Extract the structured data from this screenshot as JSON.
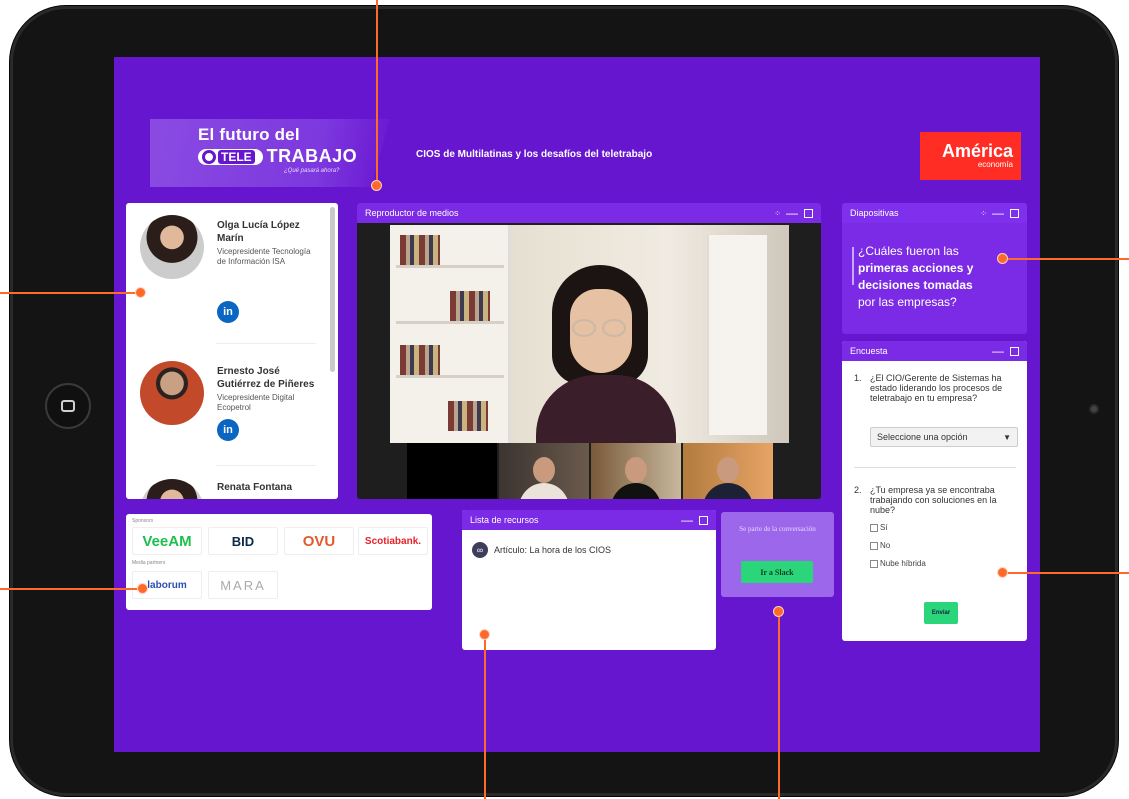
{
  "header": {
    "logo_line1": "El futuro del",
    "logo_badge": "TELE",
    "logo_trabajo": "TRABAJO",
    "logo_tagline": "¿Qué pasará ahora?",
    "event_title": "CIOS de Multilatinas y los desafíos del teletrabajo",
    "brand_big": "América",
    "brand_small": "economía"
  },
  "speakers": [
    {
      "name": "Olga Lucía López Marín",
      "role": "Vicepresidente Tecnología de Información ISA",
      "linkedin": "in"
    },
    {
      "name": "Ernesto José Gutiérrez de Piñeres",
      "role": "Vicepresidente Digital Ecopetrol",
      "linkedin": "in"
    },
    {
      "name": "Renata Fontana",
      "role": "",
      "linkedin": ""
    }
  ],
  "sponsors": {
    "sponsors_label": "Sponsors",
    "media_label": "Media partners",
    "items": [
      "VeeAM",
      "BID",
      "OVU",
      "Scotiabank."
    ],
    "media_items": [
      "laborum",
      "MARA"
    ]
  },
  "player": {
    "title": "Reproductor de medios"
  },
  "slides": {
    "title": "Diapositivas",
    "line1": "¿Cuáles fueron las",
    "line2": "primeras acciones y",
    "line3": "decisiones tomadas",
    "line4": "por las empresas?"
  },
  "poll": {
    "title": "Encuesta",
    "q1_num": "1.",
    "q1_text": "¿El CIO/Gerente de Sistemas ha estado liderando los procesos de teletrabajo en tu empresa?",
    "q1_select": "Seleccione una opción",
    "q2_num": "2.",
    "q2_text": "¿Tu empresa ya se encontraba trabajando con soluciones en la nube?",
    "options": [
      "Sí",
      "No",
      "Nube híbrida"
    ],
    "submit": "Enviar"
  },
  "resources": {
    "title": "Lista de recursos",
    "items": [
      "Artículo: La hora de los CIOS"
    ]
  },
  "slack": {
    "text": "Se parte de la conversación",
    "button": "Ir a Slack"
  },
  "colors": {
    "background": "#6716cf",
    "panel_header": "#7b2ae6",
    "accent_green": "#2bd67a",
    "brand_red": "#ff2d24",
    "annotation": "#ff6a2b"
  },
  "icons": {
    "home_button": "square-outline",
    "resource_item": "link-icon",
    "linkedin": "linkedin-icon"
  }
}
